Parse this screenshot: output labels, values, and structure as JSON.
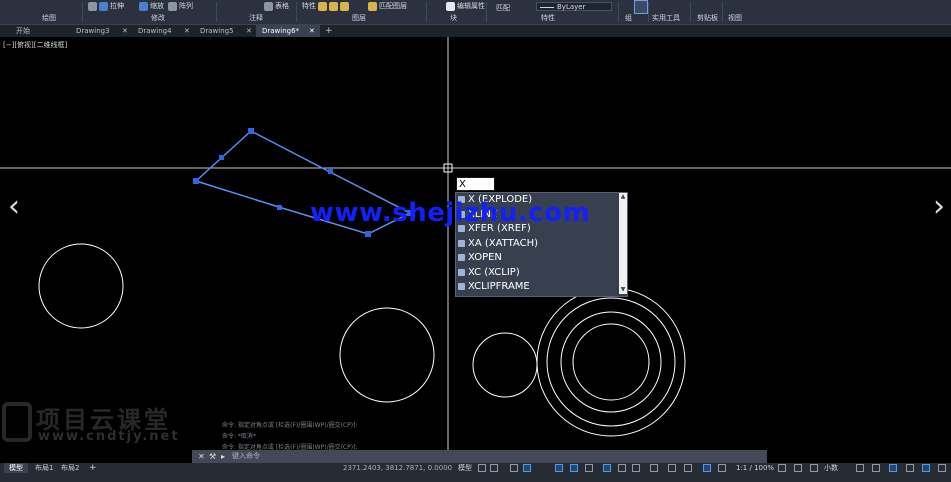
{
  "ribbon": {
    "tools": [
      "拉伸",
      "缩放",
      "阵列",
      "表格",
      "特性",
      "匹配图层",
      "编辑属性",
      "匹配",
      "ByLayer"
    ],
    "groups": [
      "绘图",
      "修改",
      "注释",
      "图层",
      "块",
      "特性",
      "组",
      "实用工具",
      "剪贴板",
      "视图"
    ]
  },
  "tabs": [
    {
      "label": "开始",
      "closable": false,
      "active": false
    },
    {
      "label": "Drawing3",
      "closable": true,
      "active": false
    },
    {
      "label": "Drawing4",
      "closable": true,
      "active": false
    },
    {
      "label": "Drawing5",
      "closable": true,
      "active": false
    },
    {
      "label": "Drawing6*",
      "closable": true,
      "active": true
    }
  ],
  "new_tab_icon": "plus-icon",
  "viewport_label": "[−][俯视][二维线框]",
  "command_input_value": "X",
  "autocomplete": [
    {
      "label": "X (EXPLODE)",
      "icon": "explode-icon"
    },
    {
      "label": "XLINE",
      "icon": "xline-icon"
    },
    {
      "label": "XFER (XREF)",
      "icon": "xref-icon"
    },
    {
      "label": "XA (XATTACH)",
      "icon": "xattach-icon"
    },
    {
      "label": "XOPEN",
      "icon": "xopen-icon"
    },
    {
      "label": "XC (XCLIP)",
      "icon": "xclip-icon"
    },
    {
      "label": "XCLIPFRAME",
      "icon": "xclipframe-icon"
    }
  ],
  "watermark": "www.shejizhu.com",
  "logo": {
    "main": "项目云课堂",
    "sub": "www.cndtjy.net"
  },
  "command_history": [
    "命令: 指定对角点或 [栏选(F)/圈围(WP)/圈交(CP)]:",
    "命令: *取消*",
    "命令: 指定对角点或 [栏选(F)/圈围(WP)/圈交(CP)]:"
  ],
  "command_prompt": "键入命令",
  "layout_tabs": [
    {
      "label": "模型",
      "active": true
    },
    {
      "label": "布局1",
      "active": false
    },
    {
      "label": "布局2",
      "active": false
    }
  ],
  "coordinates": "2371.2403, 3812.7871, 0.0000",
  "status": {
    "model_label": "模型",
    "scale": "1:1 / 100%",
    "units": "小数"
  },
  "colors": {
    "selection": "#5a8ef0",
    "grip": "#2f66e8",
    "watermark": "#1020ff",
    "background": "#000000"
  }
}
